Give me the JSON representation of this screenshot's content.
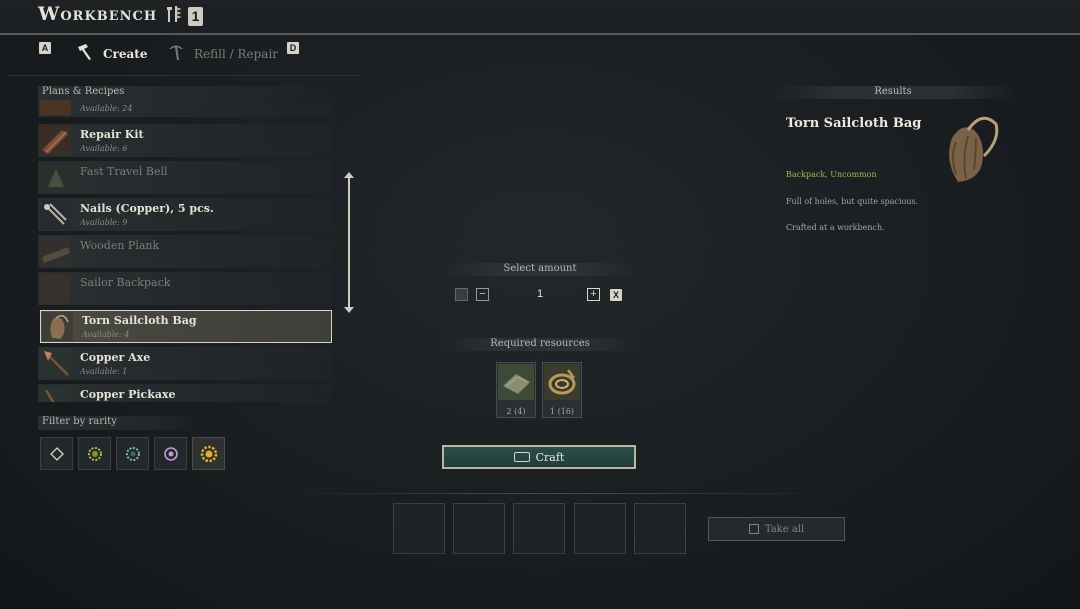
{
  "header": {
    "title": "Workbench",
    "badge": "1"
  },
  "tabs": {
    "prev_key": "A",
    "create_label": "Create",
    "refill_label": "Refill / Repair",
    "next_key": "D"
  },
  "recipes": {
    "header": "Plans & Recipes",
    "items": [
      {
        "name": "",
        "sub": "Available: 24",
        "state": "partial"
      },
      {
        "name": "Repair Kit",
        "sub": "Available: 6",
        "state": "normal"
      },
      {
        "name": "Fast Travel Bell",
        "sub": "",
        "state": "dim"
      },
      {
        "name": "Nails (Copper), 5 pcs.",
        "sub": "Available: 9",
        "state": "normal"
      },
      {
        "name": "Wooden Plank",
        "sub": "",
        "state": "dim"
      },
      {
        "name": "Sailor Backpack",
        "sub": "",
        "state": "dim"
      },
      {
        "name": "Torn Sailcloth Bag",
        "sub": "Available: 4",
        "state": "selected"
      },
      {
        "name": "Copper Axe",
        "sub": "Available: 1",
        "state": "normal"
      },
      {
        "name": "Copper Pickaxe",
        "sub": "",
        "state": "partial"
      }
    ]
  },
  "filter": {
    "header": "Filter by rarity"
  },
  "amount": {
    "header": "Select amount",
    "value": "1",
    "max_key": "X"
  },
  "required": {
    "header": "Required resources",
    "items": [
      {
        "qty": "2 (4)",
        "icon": "cloth-icon"
      },
      {
        "qty": "1 (16)",
        "icon": "rope-icon"
      }
    ]
  },
  "craft": {
    "label": "Craft"
  },
  "take_all": {
    "label": "Take all"
  },
  "result": {
    "header": "Results",
    "name": "Torn Sailcloth Bag",
    "rarity": "Backpack, Uncommon",
    "desc1": "Full of holes, but quite spacious.",
    "desc2": "Crafted at a workbench."
  },
  "colors": {
    "accent_green": "#8cc04a",
    "craft_teal": "#2b4e48",
    "text": "#d8d4c8"
  }
}
